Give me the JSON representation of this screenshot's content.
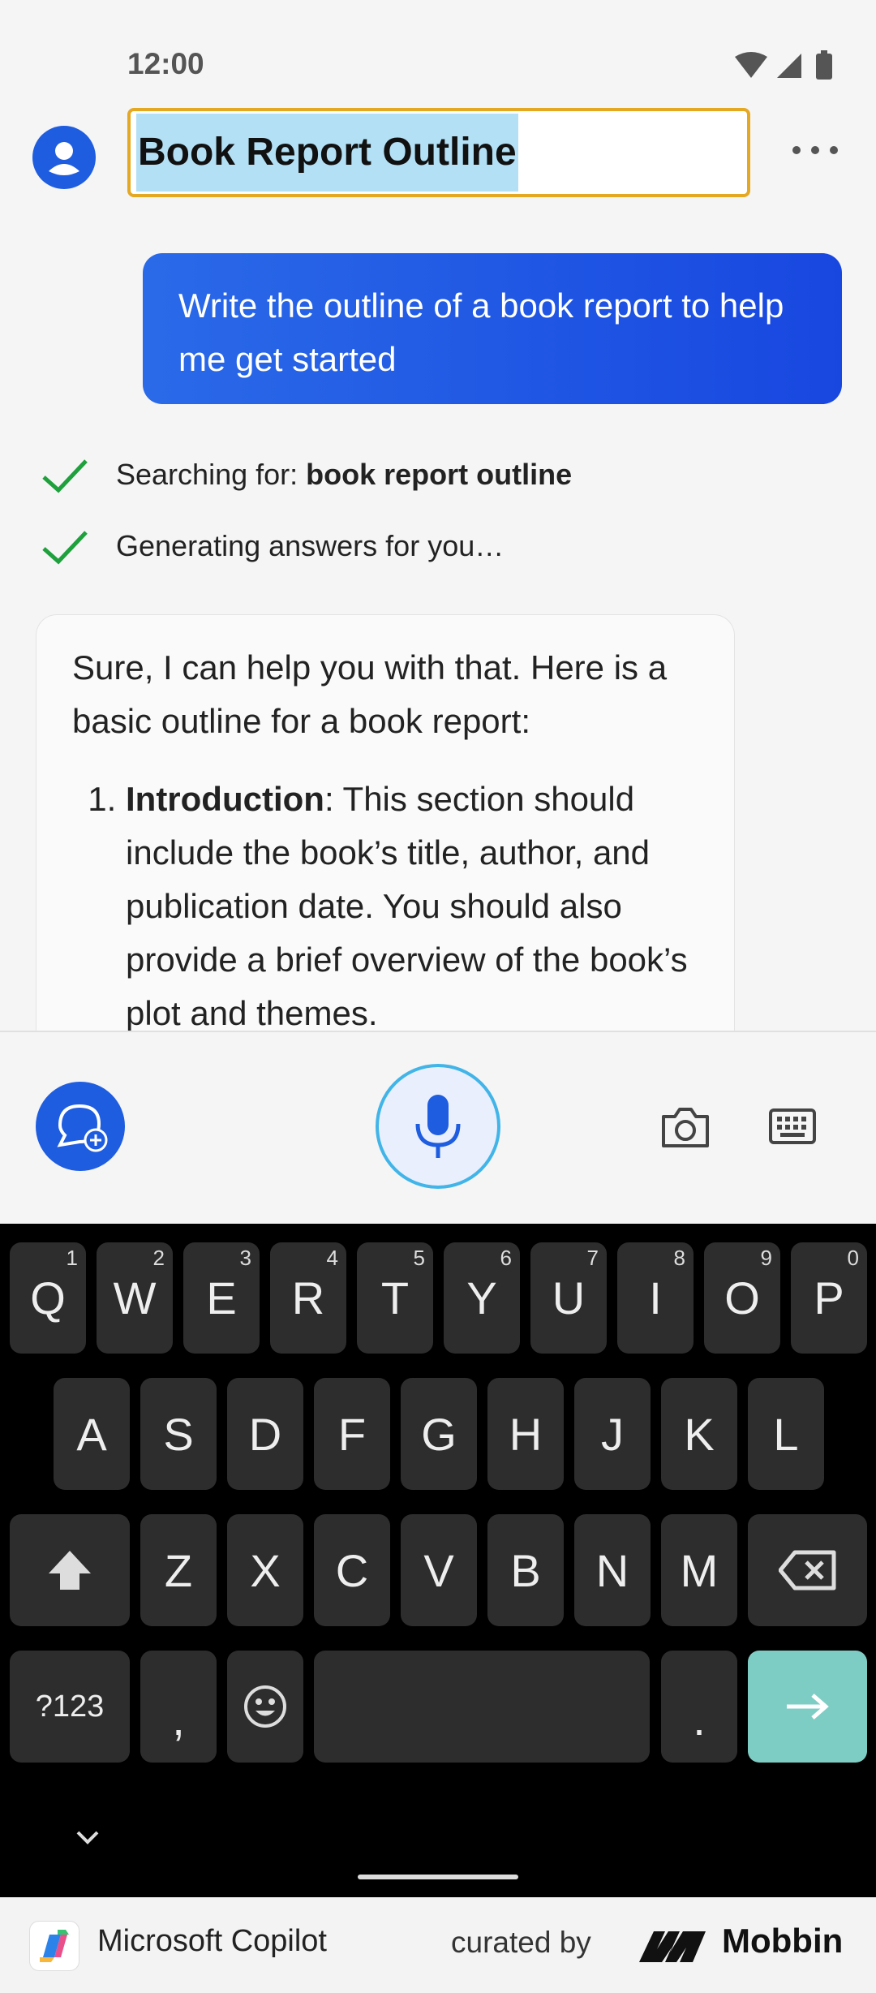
{
  "status_bar": {
    "time": "12:00"
  },
  "header": {
    "title": "Book Report Outline"
  },
  "chat": {
    "user_message": "Write the outline of a book report to help me get started",
    "steps": [
      {
        "prefix": "Searching for: ",
        "bold": "book report outline"
      },
      {
        "text": "Generating answers for you…"
      }
    ],
    "answer": {
      "intro": "Sure, I can help you with that. Here is a basic outline for a book report:",
      "items": [
        {
          "title": "Introduction",
          "text": ": This section should include the book’s title, author, and publication date. You should also provide a brief overview of the book’s plot and themes."
        }
      ]
    }
  },
  "keyboard": {
    "row1": [
      {
        "letter": "Q",
        "num": "1"
      },
      {
        "letter": "W",
        "num": "2"
      },
      {
        "letter": "E",
        "num": "3"
      },
      {
        "letter": "R",
        "num": "4"
      },
      {
        "letter": "T",
        "num": "5"
      },
      {
        "letter": "Y",
        "num": "6"
      },
      {
        "letter": "U",
        "num": "7"
      },
      {
        "letter": "I",
        "num": "8"
      },
      {
        "letter": "O",
        "num": "9"
      },
      {
        "letter": "P",
        "num": "0"
      }
    ],
    "row2": [
      "A",
      "S",
      "D",
      "F",
      "G",
      "H",
      "J",
      "K",
      "L"
    ],
    "row3": [
      "Z",
      "X",
      "C",
      "V",
      "B",
      "N",
      "M"
    ],
    "symbols_label": "?123",
    "comma": ",",
    "period": "."
  },
  "footer": {
    "app_name": "Microsoft Copilot",
    "curated_by": "curated by",
    "brand": "Mobbin"
  },
  "colors": {
    "accent": "#1f5de0",
    "title_border": "#e5a823",
    "send_key": "#7ecdc4",
    "check": "#1ea03c"
  }
}
